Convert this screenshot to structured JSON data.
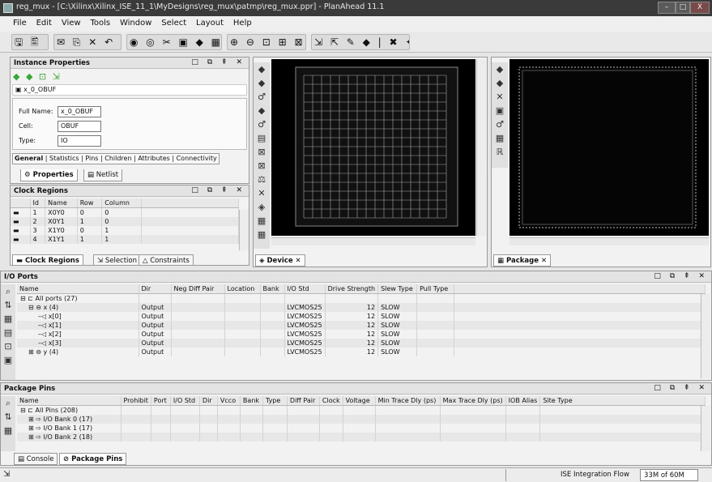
{
  "window": {
    "title": "reg_mux - [C:\\Xilinx\\Xilinx_ISE_11_1\\MyDesigns\\reg_mux\\patmp\\reg_mux.ppr] - PlanAhead 11.1",
    "buttons": [
      "–",
      "□",
      "X"
    ]
  },
  "menu": [
    "File",
    "Edit",
    "View",
    "Tools",
    "Window",
    "Select",
    "Layout",
    "Help"
  ],
  "toolbar": {
    "groups": [
      "🖫 🖺",
      "✉ ⎘ ✕ ↶",
      "◉ ◎ ✂ ▣ ◆ ▦",
      "⊕ ⊖ ⊡ ⊞ ⊠",
      "⇲ ⇱ ✎ ◆ | ✖ ✦ ✗"
    ]
  },
  "instance_properties": {
    "title": "Instance Properties",
    "controls": "□ ⧉ ⇞ ✕",
    "toolbar_icons": "◆ ◆ ⊡ ⇲",
    "instance_name": "x_0_OBUF",
    "fields": [
      {
        "label": "Full Name:",
        "value": "x_0_OBUF"
      },
      {
        "label": "Cell:",
        "value": "OBUF"
      },
      {
        "label": "Type:",
        "value": "IO"
      }
    ],
    "subtabs": [
      "General",
      "Statistics",
      "Pins",
      "Children",
      "Attributes",
      "Connectivity"
    ],
    "bottom_tabs": [
      "Properties",
      "Netlist"
    ]
  },
  "clock_regions": {
    "title": "Clock Regions",
    "controls": "□ ⧉ ⇞ ✕",
    "columns": [
      "Id",
      "Name",
      "Row",
      "Column"
    ],
    "rows": [
      {
        "id": "1",
        "name": "X0Y0",
        "row": "0",
        "column": "0"
      },
      {
        "id": "2",
        "name": "X0Y1",
        "row": "1",
        "column": "0"
      },
      {
        "id": "3",
        "name": "X1Y0",
        "row": "0",
        "column": "1"
      },
      {
        "id": "4",
        "name": "X1Y1",
        "row": "1",
        "column": "1"
      }
    ],
    "bottom_tabs": [
      "Clock Regions",
      "Selection",
      "Constraints"
    ]
  },
  "device_view": {
    "tab": "Device",
    "tool_icons": [
      "◆",
      "◆",
      "♂",
      "◆",
      "♂",
      "▤",
      "⊠",
      "⊠",
      "⚖",
      "✕",
      "◈",
      "▦",
      "▦"
    ]
  },
  "package_view": {
    "tab": "Package",
    "tool_icons": [
      "◆",
      "◆",
      "✕",
      "▣",
      "♂",
      "▦",
      "ℝ"
    ]
  },
  "io_ports": {
    "title": "I/O Ports",
    "controls": "□ ⧉ ⇞ ✕",
    "columns": [
      "Name",
      "Dir",
      "Neg Diff Pair",
      "Location",
      "Bank",
      "I/O Std",
      "Drive Strength",
      "Slew Type",
      "Pull Type"
    ],
    "rows": [
      {
        "name": "⊟ ⊏ All ports (27)",
        "dir": "",
        "iostd": "",
        "drive": "",
        "slew": "",
        "indent": 0
      },
      {
        "name": "⊟ ⊖ x (4)",
        "dir": "Output",
        "iostd": "LVCMOS25",
        "drive": "12",
        "slew": "SLOW",
        "indent": 1
      },
      {
        "name": "–◁ x[0]",
        "dir": "Output",
        "iostd": "LVCMOS25",
        "drive": "12",
        "slew": "SLOW",
        "indent": 2
      },
      {
        "name": "–◁ x[1]",
        "dir": "Output",
        "iostd": "LVCMOS25",
        "drive": "12",
        "slew": "SLOW",
        "indent": 2
      },
      {
        "name": "–◁ x[2]",
        "dir": "Output",
        "iostd": "LVCMOS25",
        "drive": "12",
        "slew": "SLOW",
        "indent": 2
      },
      {
        "name": "–◁ x[3]",
        "dir": "Output",
        "iostd": "LVCMOS25",
        "drive": "12",
        "slew": "SLOW",
        "indent": 2
      },
      {
        "name": "⊞ ⊖ y (4)",
        "dir": "Output",
        "iostd": "LVCMOS25",
        "drive": "12",
        "slew": "SLOW",
        "indent": 1
      }
    ],
    "side_icons": [
      "⌕",
      "⇅",
      "▦",
      "▤",
      "⊡",
      "▣"
    ]
  },
  "package_pins": {
    "title": "Package Pins",
    "controls": "□ ⧉ ⇞ ✕",
    "columns": [
      "Name",
      "Prohibit",
      "Port",
      "I/O Std",
      "Dir",
      "Vcco",
      "Bank",
      "Type",
      "Diff Pair",
      "Clock",
      "Voltage",
      "Min Trace Dly (ps)",
      "Max Trace Dly (ps)",
      "IOB Alias",
      "Site Type"
    ],
    "rows": [
      {
        "name": "⊟ ⊏ All Pins (208)",
        "indent": 0
      },
      {
        "name": "⊞ ⇨ I/O Bank 0 (17)",
        "indent": 1
      },
      {
        "name": "⊞ ⇨ I/O Bank 1 (17)",
        "indent": 1
      },
      {
        "name": "⊞ ⇨ I/O Bank 2 (18)",
        "indent": 1
      }
    ],
    "side_icons": [
      "⌕",
      "⇅",
      "▦"
    ],
    "bottom_tabs": [
      "Console",
      "Package Pins"
    ]
  },
  "status": {
    "flow": "ISE Integration Flow",
    "memory": "33M of 60M"
  }
}
